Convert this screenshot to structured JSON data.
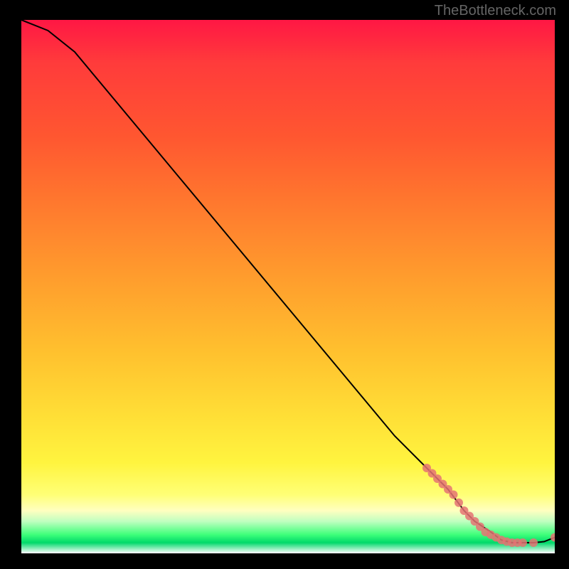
{
  "watermark": "TheBottleneck.com",
  "chart_data": {
    "type": "line",
    "title": "",
    "xlabel": "",
    "ylabel": "",
    "xlim": [
      0,
      100
    ],
    "ylim": [
      0,
      100
    ],
    "grid": false,
    "series": [
      {
        "name": "curve",
        "x": [
          0,
          5,
          10,
          15,
          20,
          25,
          30,
          35,
          40,
          45,
          50,
          55,
          60,
          65,
          70,
          75,
          80,
          83,
          85,
          88,
          90,
          92,
          94,
          96,
          98,
          100
        ],
        "values": [
          100,
          98,
          94,
          88,
          82,
          76,
          70,
          64,
          58,
          52,
          46,
          40,
          34,
          28,
          22,
          17,
          12,
          8,
          6,
          4,
          2.5,
          2,
          2,
          2,
          2.2,
          3
        ],
        "color": "#000000"
      }
    ],
    "markers": [
      {
        "x": 76,
        "y": 16
      },
      {
        "x": 77,
        "y": 15
      },
      {
        "x": 78,
        "y": 14
      },
      {
        "x": 79,
        "y": 13
      },
      {
        "x": 80,
        "y": 12
      },
      {
        "x": 81,
        "y": 11
      },
      {
        "x": 82,
        "y": 9.5
      },
      {
        "x": 83,
        "y": 8
      },
      {
        "x": 84,
        "y": 7
      },
      {
        "x": 85,
        "y": 6
      },
      {
        "x": 86,
        "y": 5
      },
      {
        "x": 87,
        "y": 4
      },
      {
        "x": 88,
        "y": 3.5
      },
      {
        "x": 89,
        "y": 3
      },
      {
        "x": 90,
        "y": 2.5
      },
      {
        "x": 91,
        "y": 2.2
      },
      {
        "x": 92,
        "y": 2
      },
      {
        "x": 93,
        "y": 2
      },
      {
        "x": 94,
        "y": 2
      },
      {
        "x": 96,
        "y": 2
      },
      {
        "x": 100,
        "y": 3
      }
    ],
    "marker_color": "#e57373"
  }
}
